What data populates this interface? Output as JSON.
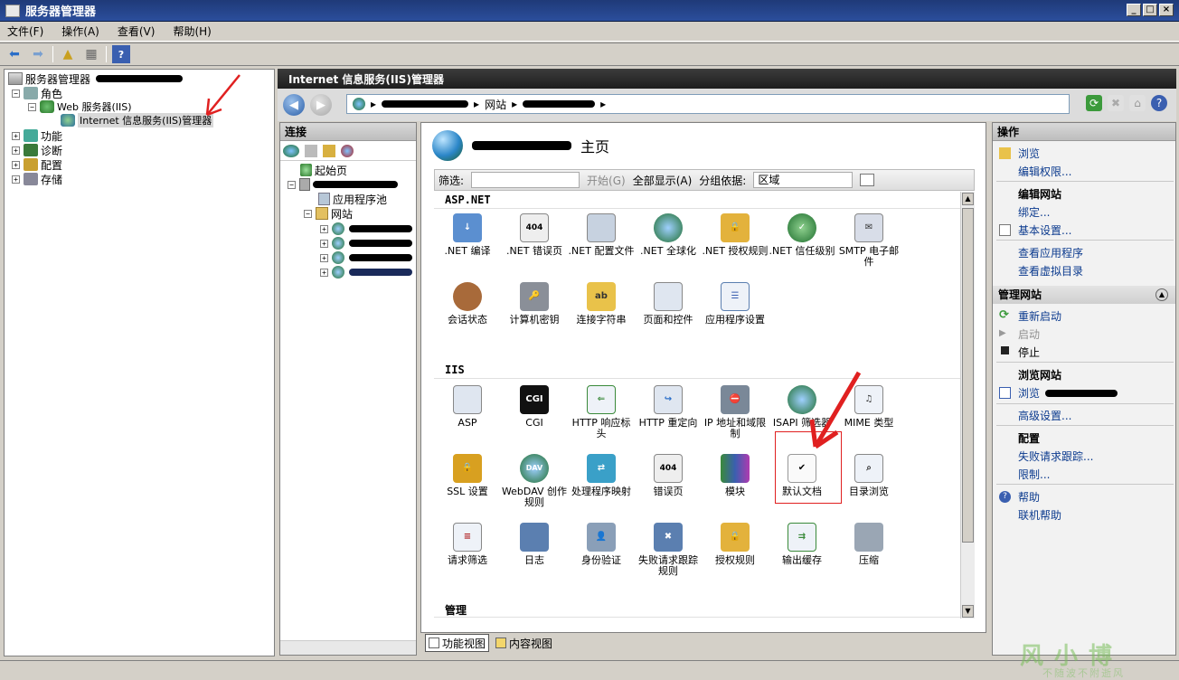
{
  "window": {
    "title": "服务器管理器",
    "controls": [
      "_",
      "□",
      "×"
    ]
  },
  "menu": [
    "文件(F)",
    "操作(A)",
    "查看(V)",
    "帮助(H)"
  ],
  "left_tree": {
    "root": "服务器管理器",
    "roles": "角色",
    "web_server": "Web 服务器(IIS)",
    "iis_manager": "Internet 信息服务(IIS)管理器",
    "features": "功能",
    "diagnostics": "诊断",
    "config": "配置",
    "storage": "存储"
  },
  "iis_title": "Internet 信息服务(IIS)管理器",
  "address": {
    "seg_sites": "网站"
  },
  "connections": {
    "header": "连接",
    "start_page": "起始页",
    "app_pools": "应用程序池",
    "sites": "网站"
  },
  "center": {
    "home_label": "主页",
    "filter_label": "筛选:",
    "start_label": "开始(G)",
    "show_all_label": "全部显示(A)",
    "group_by_label": "分组依据:",
    "group_by_value": "区域",
    "sections": {
      "aspnet": "ASP.NET",
      "iis": "IIS",
      "manage": "管理"
    },
    "aspnet_features": [
      ".NET 编译",
      ".NET 错误页",
      ".NET 配置文件",
      ".NET 全球化",
      ".NET 授权规则",
      ".NET 信任级别",
      "SMTP 电子邮件",
      "会话状态",
      "计算机密钥",
      "连接字符串",
      "页面和控件",
      "应用程序设置"
    ],
    "iis_features": [
      "ASP",
      "CGI",
      "HTTP 响应标头",
      "HTTP 重定向",
      "IP 地址和域限制",
      "ISAPI 筛选器",
      "MIME 类型",
      "SSL 设置",
      "WebDAV 创作规则",
      "处理程序映射",
      "错误页",
      "模块",
      "默认文档",
      "目录浏览",
      "请求筛选",
      "日志",
      "身份验证",
      "失败请求跟踪规则",
      "授权规则",
      "输出缓存",
      "压缩"
    ]
  },
  "view_tabs": {
    "features_view": "功能视图",
    "content_view": "内容视图"
  },
  "actions": {
    "header": "操作",
    "browse": "浏览",
    "edit_perms": "编辑权限...",
    "edit_site": "编辑网站",
    "bindings": "绑定...",
    "basic_settings": "基本设置...",
    "view_apps": "查看应用程序",
    "view_vdirs": "查看虚拟目录",
    "manage_site": "管理网站",
    "restart": "重新启动",
    "start": "启动",
    "stop": "停止",
    "browse_site": "浏览网站",
    "browse_prefix": "浏览",
    "advanced": "高级设置...",
    "config": "配置",
    "failed_trace": "失败请求跟踪...",
    "limits": "限制...",
    "help": "帮助",
    "online_help": "联机帮助"
  },
  "watermark": {
    "main": "风小博",
    "sub": "不随波不附逝风"
  },
  "colors": {
    "highlight": "#e02020",
    "link": "#0b3a8e",
    "title_bg": "#1f3a78"
  }
}
